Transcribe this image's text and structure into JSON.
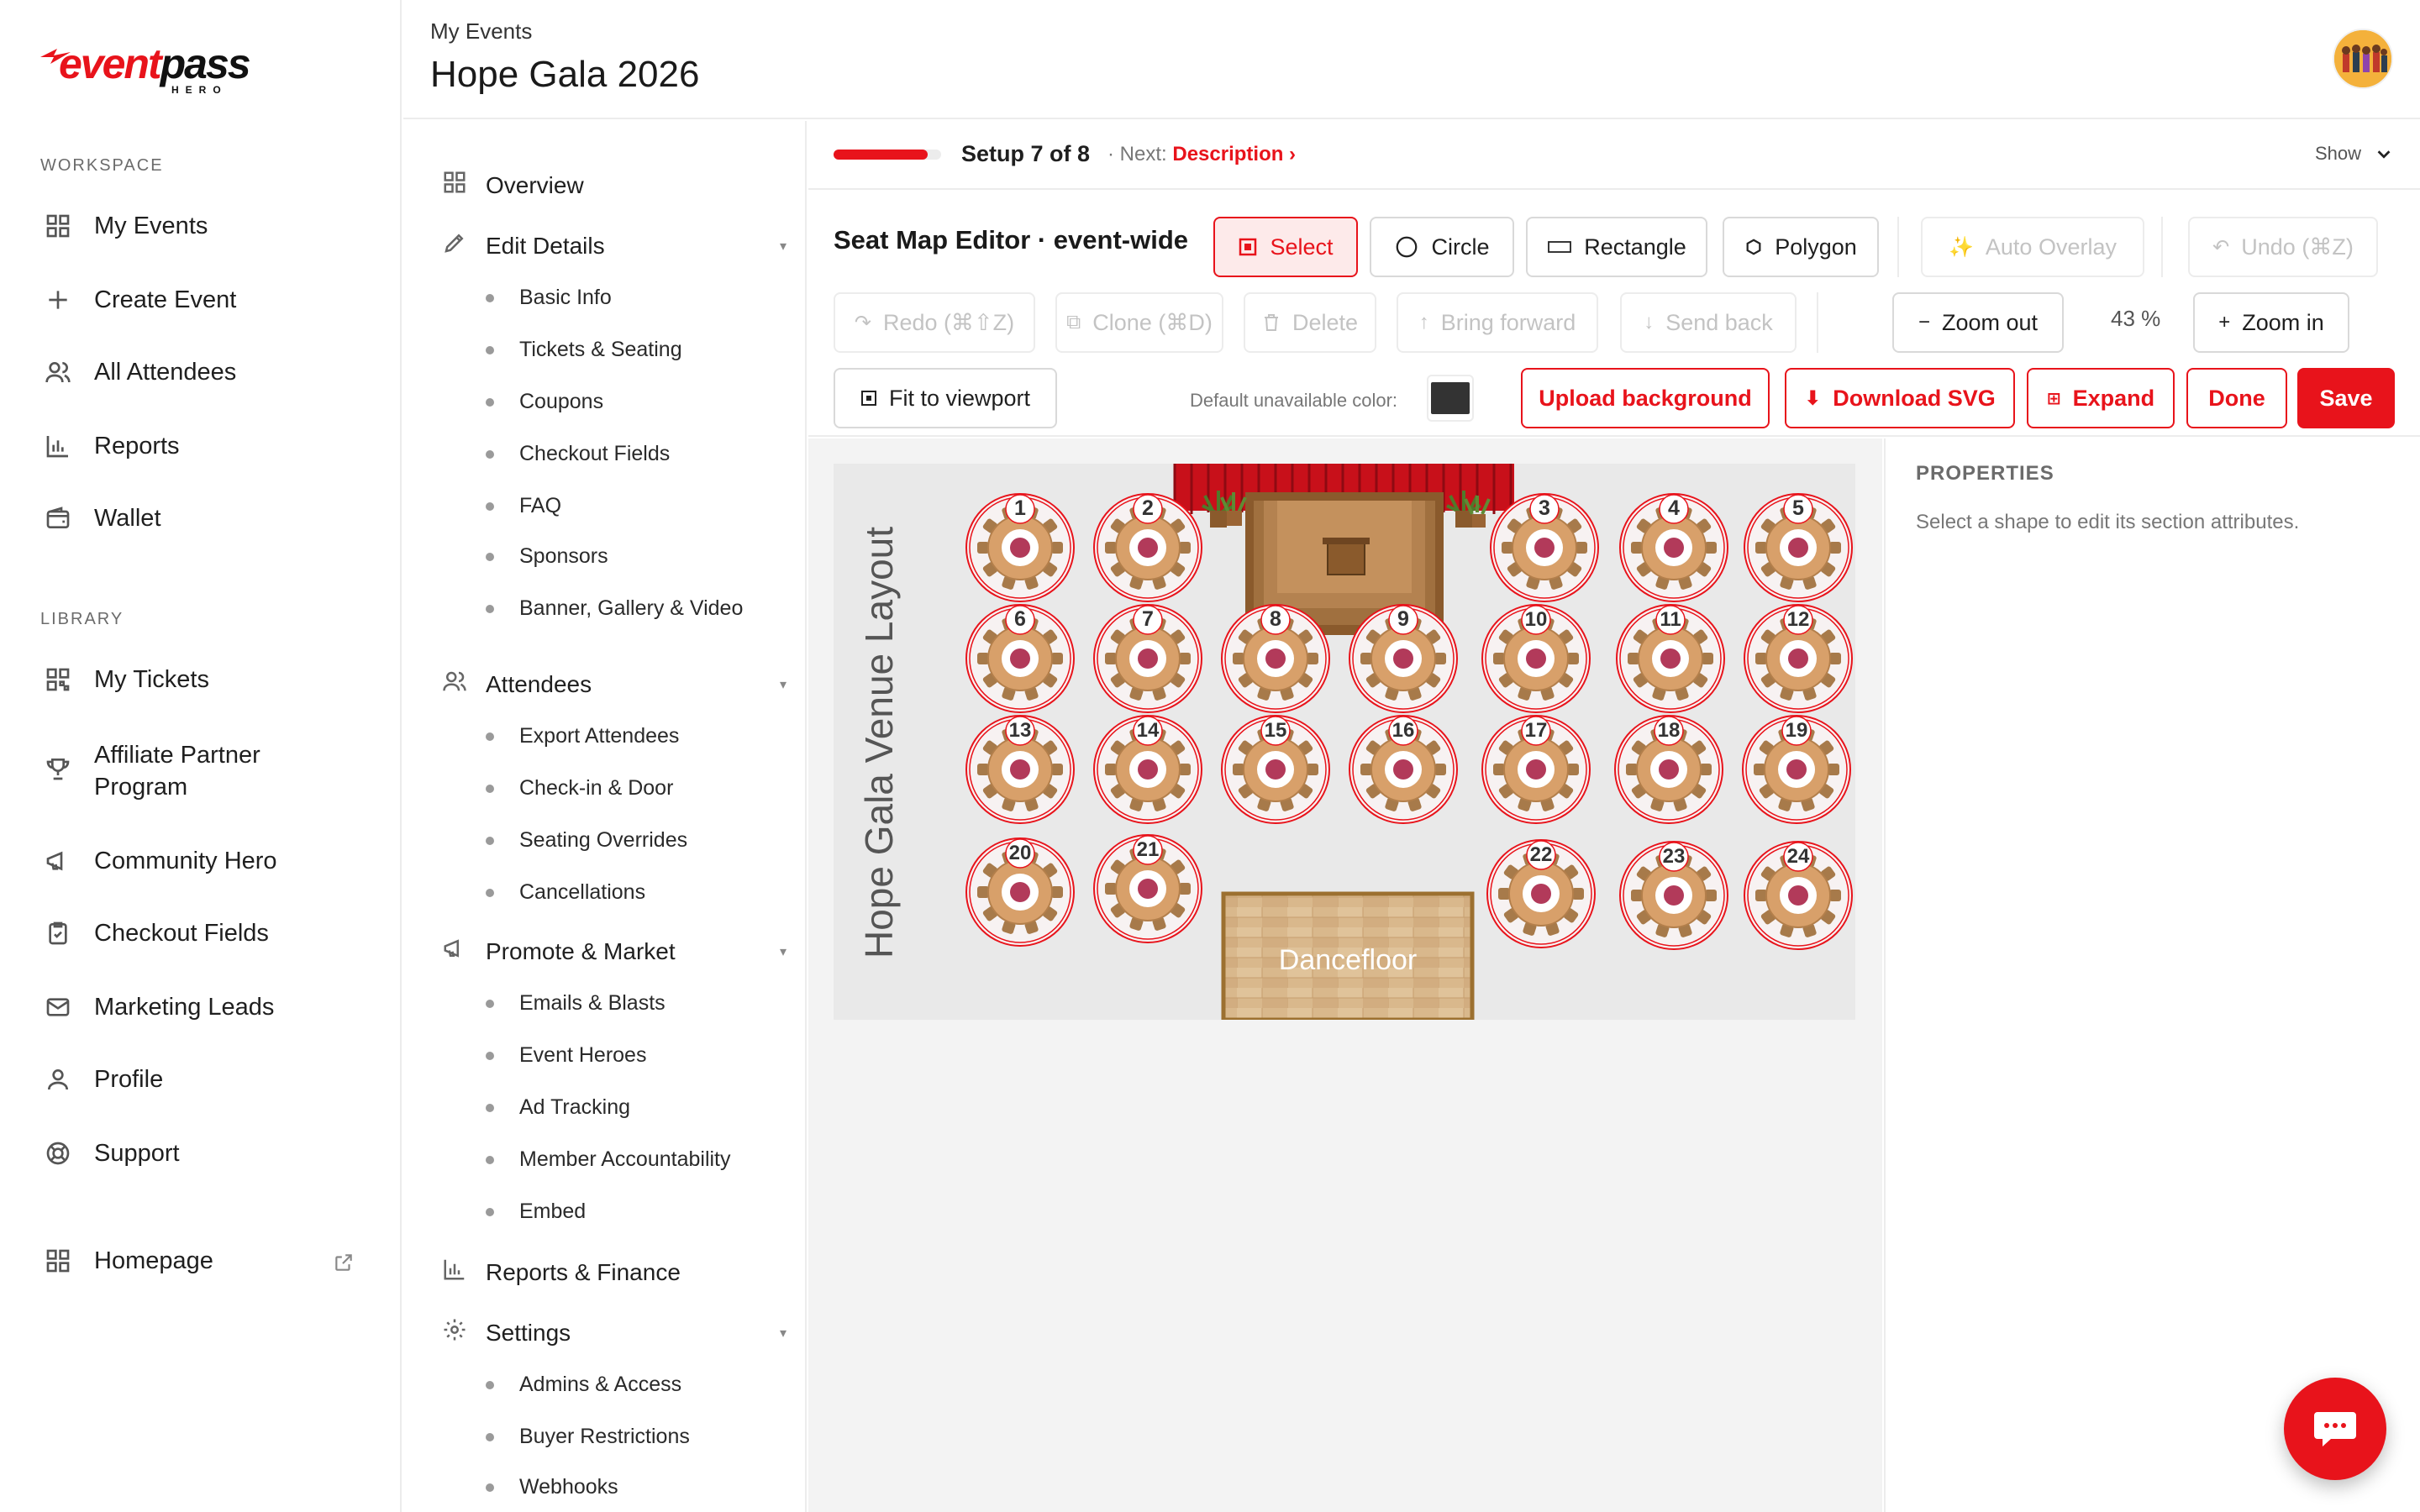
{
  "brand": {
    "name_accent": "event",
    "name_main": "pass",
    "sub": "HERO"
  },
  "sidebar": {
    "workspace_label": "WORKSPACE",
    "library_label": "LIBRARY",
    "workspace_items": [
      {
        "label": "My Events",
        "icon": "grid-icon"
      },
      {
        "label": "Create Event",
        "icon": "plus-icon"
      },
      {
        "label": "All Attendees",
        "icon": "users-icon"
      },
      {
        "label": "Reports",
        "icon": "bar-chart-icon"
      },
      {
        "label": "Wallet",
        "icon": "wallet-icon"
      }
    ],
    "library_items": [
      {
        "label": "My Tickets",
        "icon": "qr-icon"
      },
      {
        "label": "Affiliate Partner Program",
        "icon": "trophy-icon"
      },
      {
        "label": "Community Hero",
        "icon": "megaphone-icon"
      },
      {
        "label": "Checkout Fields",
        "icon": "clipboard-icon"
      },
      {
        "label": "Marketing Leads",
        "icon": "mail-icon"
      },
      {
        "label": "Profile",
        "icon": "user-icon"
      },
      {
        "label": "Support",
        "icon": "lifebuoy-icon"
      }
    ],
    "homepage_label": "Homepage"
  },
  "header": {
    "breadcrumb": "My Events",
    "title": "Hope Gala 2026"
  },
  "subnav": {
    "overview": "Overview",
    "edit_details": {
      "label": "Edit Details",
      "items": [
        "Basic Info",
        "Tickets & Seating",
        "Coupons",
        "Checkout Fields",
        "FAQ",
        "Sponsors",
        "Banner, Gallery & Video"
      ]
    },
    "attendees": {
      "label": "Attendees",
      "items": [
        "Export Attendees",
        "Check-in & Door",
        "Seating Overrides",
        "Cancellations"
      ]
    },
    "promote": {
      "label": "Promote & Market",
      "items": [
        "Emails & Blasts",
        "Event Heroes",
        "Ad Tracking",
        "Member Accountability",
        "Embed"
      ]
    },
    "reports_finance": "Reports & Finance",
    "settings": {
      "label": "Settings",
      "items": [
        "Admins & Access",
        "Buyer Restrictions",
        "Webhooks"
      ]
    }
  },
  "progress": {
    "setup_text": "Setup 7 of 8",
    "next_prefix": "· Next:",
    "next_link": "Description ›",
    "fraction": 0.875,
    "show_label": "Show"
  },
  "editor": {
    "title": "Seat Map Editor · event-wide",
    "tools": {
      "select": "Select",
      "circle": "Circle",
      "rectangle": "Rectangle",
      "polygon": "Polygon"
    },
    "auto_overlay": "Auto Overlay",
    "undo": "Undo (⌘Z)",
    "redo": "Redo (⌘⇧Z)",
    "clone": "Clone (⌘D)",
    "delete": "Delete",
    "bring_forward": "Bring forward",
    "send_back": "Send back",
    "zoom_out": "Zoom out",
    "zoom_value": "43 %",
    "zoom_in": "Zoom in",
    "fit": "Fit to viewport",
    "color_label": "Default unavailable color:",
    "unavailable_color": "#333333",
    "upload_bg": "Upload background",
    "download_svg": "Download SVG",
    "expand": "Expand",
    "done": "Done",
    "save": "Save"
  },
  "seatmap": {
    "venue_title": "Hope Gala Venue Layout",
    "dancefloor": "Dancefloor",
    "tables": [
      "1",
      "2",
      "3",
      "4",
      "5",
      "6",
      "7",
      "8",
      "9",
      "10",
      "11",
      "12",
      "13",
      "14",
      "15",
      "16",
      "17",
      "18",
      "19",
      "20",
      "21",
      "22",
      "23",
      "24"
    ]
  },
  "properties": {
    "title": "PROPERTIES",
    "hint": "Select a shape to edit its section attributes."
  },
  "colors": {
    "accent": "#e8131b",
    "table_wood": "#d8a06a",
    "stage_wood": "#a0703f",
    "curtain": "#c8101a"
  }
}
